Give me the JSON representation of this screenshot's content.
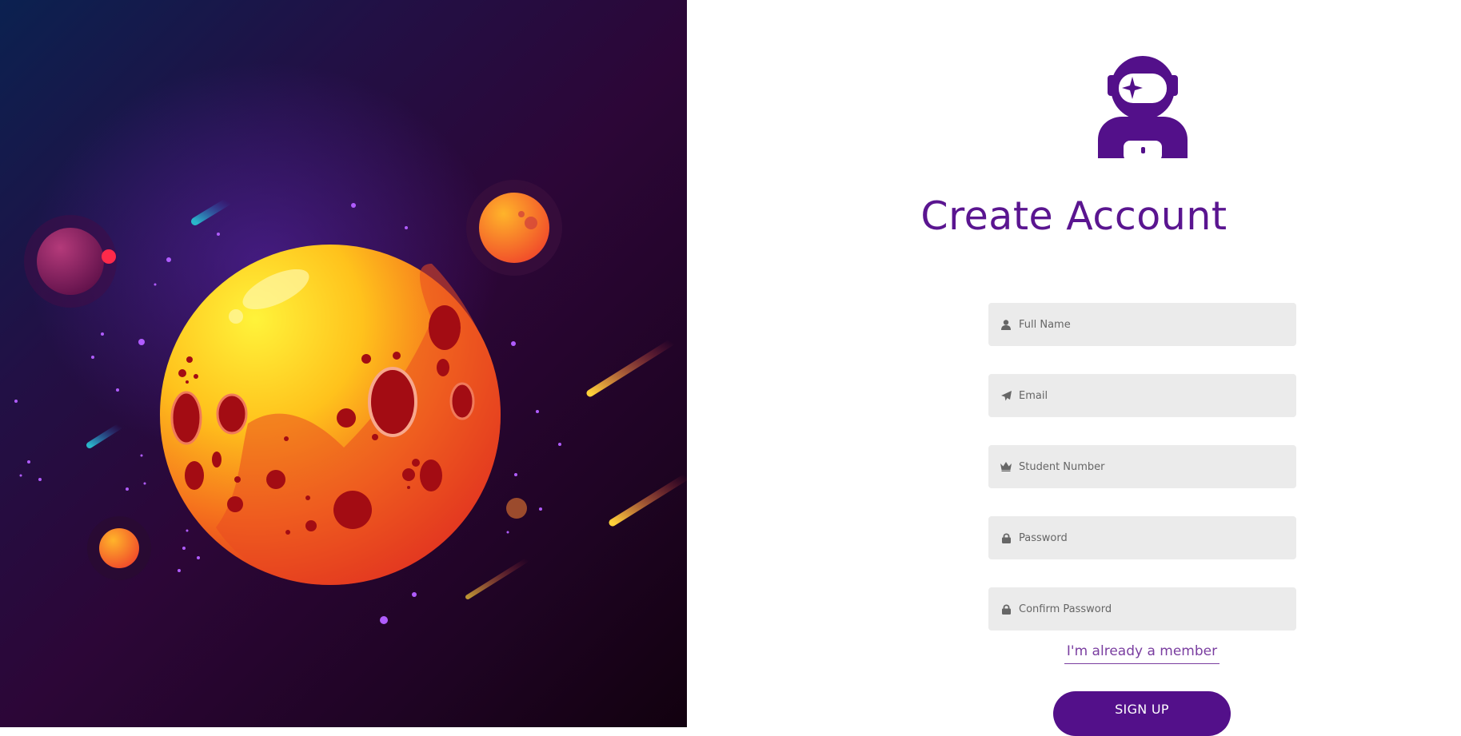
{
  "form": {
    "title": "Create Account",
    "fields": [
      {
        "placeholder": "Full Name",
        "icon": "user-icon"
      },
      {
        "placeholder": "Email",
        "icon": "paper-plane-icon"
      },
      {
        "placeholder": "Student Number",
        "icon": "crown-icon"
      },
      {
        "placeholder": "Password",
        "icon": "lock-icon"
      },
      {
        "placeholder": "Confirm Password",
        "icon": "lock-icon"
      }
    ],
    "member_link": "I'm already a member",
    "submit_label": "SIGN UP"
  },
  "logo": {
    "icon": "astronaut-icon"
  },
  "illustration": {
    "icon": "planet-space-illustration"
  },
  "colors": {
    "accent": "#53108a",
    "title": "#5a1590",
    "field_bg": "#ebebeb"
  }
}
